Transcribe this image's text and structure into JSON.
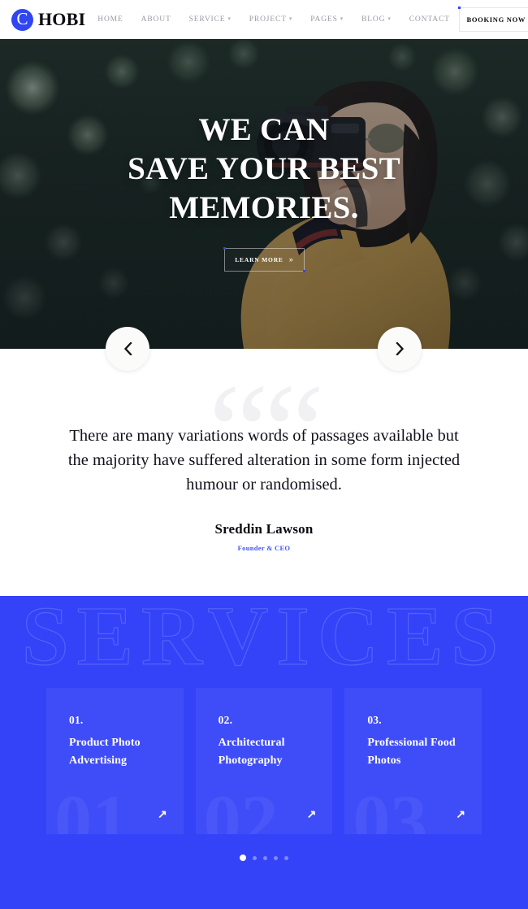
{
  "header": {
    "logo_icon": "circle-c-logo-icon",
    "logo_letter": "C",
    "brand_name": "HOBI",
    "nav": [
      {
        "label": "HOME",
        "has_dropdown": false
      },
      {
        "label": "ABOUT",
        "has_dropdown": false
      },
      {
        "label": "SERVICE",
        "has_dropdown": true
      },
      {
        "label": "PROJECT",
        "has_dropdown": true
      },
      {
        "label": "PAGES",
        "has_dropdown": true
      },
      {
        "label": "BLOG",
        "has_dropdown": true
      },
      {
        "label": "CONTACT",
        "has_dropdown": false
      }
    ],
    "booking_label": "BOOKING NOW"
  },
  "hero": {
    "title_line1": "WE CAN",
    "title_line2": "SAVE YOUR BEST",
    "title_line3": "MEMORIES.",
    "cta_label": "LEARN MORE",
    "cta_chevron": "»",
    "prev_icon": "chevron-left-icon",
    "next_icon": "chevron-right-icon"
  },
  "testimonial": {
    "watermark": "““",
    "quote": "There are many variations words of passages available but the majority have suffered alteration in some form injected humour or randomised.",
    "author": "Sreddin Lawson",
    "role": "Founder & CEO"
  },
  "services": {
    "watermark": "SERVICES",
    "background_color": "#3443f8",
    "cards": [
      {
        "index": "01.",
        "bg_number": "01",
        "title": "Product Photo Advertising",
        "arrow_icon": "arrow-up-right-icon"
      },
      {
        "index": "02.",
        "bg_number": "02",
        "title": "Architectural Photography",
        "arrow_icon": "arrow-up-right-icon"
      },
      {
        "index": "03.",
        "bg_number": "03",
        "title": "Professional Food Photos",
        "arrow_icon": "arrow-up-right-icon"
      }
    ],
    "pagination": {
      "count": 5,
      "active_index": 0
    }
  },
  "colors": {
    "accent_blue": "#3443f8",
    "logo_blue": "#2f46f0",
    "role_blue": "#4457f2",
    "text_dark": "#0b0b12",
    "nav_grey": "#9a9aa6"
  }
}
